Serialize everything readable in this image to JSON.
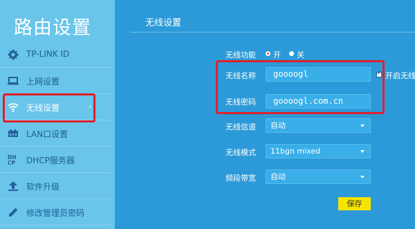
{
  "sidebar": {
    "brand": "路由设置",
    "items": [
      {
        "label": "TP-LINK ID",
        "icon": "gear-icon"
      },
      {
        "label": "上网设置",
        "icon": "laptop-icon"
      },
      {
        "label": "无线设置",
        "icon": "wifi-icon",
        "active": true
      },
      {
        "label": "LAN口设置",
        "icon": "network-icon"
      },
      {
        "label": "DHCP服务器",
        "icon": "dhcp-icon"
      },
      {
        "label": "软件升级",
        "icon": "upload-icon"
      },
      {
        "label": "修改管理员密码",
        "icon": "pencil-icon"
      }
    ],
    "active_chevron": "›"
  },
  "main": {
    "section_title": "无线设置",
    "wireless_function": {
      "label": "无线功能",
      "on": "开",
      "off": "关",
      "selected": "开"
    },
    "ssid": {
      "label": "无线名称",
      "value": "goooogl",
      "enable_label": "开启无线",
      "enabled": true
    },
    "password": {
      "label": "无线密码",
      "value": "goooogl.com.cn"
    },
    "channel": {
      "label": "无线信道",
      "value": "自动"
    },
    "mode": {
      "label": "无线模式",
      "value": "11bgn mixed"
    },
    "bandwidth": {
      "label": "频段带宽",
      "value": "自动"
    },
    "save_label": "保存"
  },
  "colors": {
    "sidebar_bg": "#69c5ea",
    "main_bg": "#2c9ad8",
    "highlight": "#e0202a",
    "save_button": "#f7e400"
  }
}
